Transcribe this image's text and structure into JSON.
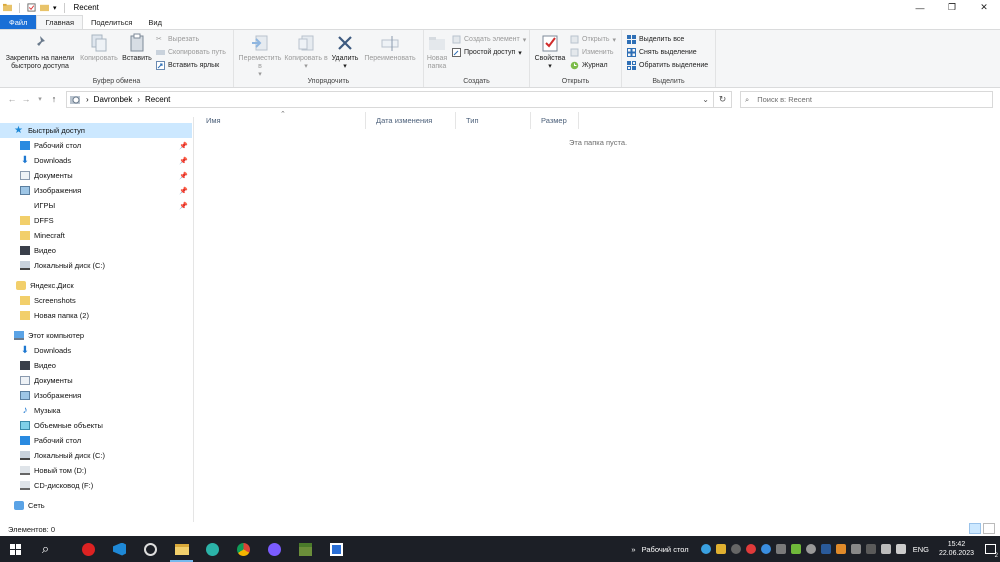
{
  "window": {
    "title": "Recent"
  },
  "tabs": [
    {
      "label": "Файл"
    },
    {
      "label": "Главная"
    },
    {
      "label": "Поделиться"
    },
    {
      "label": "Вид"
    }
  ],
  "ribbon": {
    "clipboard": {
      "label": "Буфер обмена",
      "pin_label": "Закрепить на панели быстрого доступа",
      "copy": "Копировать",
      "paste": "Вставить",
      "cut": "Вырезать",
      "copy_path": "Скопировать путь",
      "paste_shortcut": "Вставить ярлык"
    },
    "organize": {
      "label": "Упорядочить",
      "move": "Переместить в",
      "copy_to": "Копировать в",
      "delete": "Удалить",
      "rename": "Переименовать"
    },
    "create": {
      "label": "Создать",
      "new_folder": "Новая папка",
      "new_item": "Создать элемент",
      "easy_access": "Простой доступ"
    },
    "open": {
      "label": "Открыть",
      "properties": "Свойства",
      "open": "Открыть",
      "edit": "Изменить",
      "history": "Журнал"
    },
    "select": {
      "label": "Выделить",
      "select_all": "Выделить все",
      "select_none": "Снять выделение",
      "invert": "Обратить выделение"
    }
  },
  "address": {
    "crumbs": [
      "Davronbek",
      "Recent"
    ],
    "search_placeholder": "Поиск в: Recent"
  },
  "nav": {
    "quick": {
      "label": "Быстрый доступ",
      "items": [
        "Рабочий стол",
        "Downloads",
        "Документы",
        "Изображения",
        "ИГРЫ",
        "DFFS",
        "Minecraft",
        "Видео",
        "Локальный диск (C:)"
      ]
    },
    "yandex": {
      "label": "Яндекс.Диск",
      "items": [
        "Screenshots",
        "Новая папка (2)"
      ]
    },
    "pc": {
      "label": "Этот компьютер",
      "items": [
        "Downloads",
        "Видео",
        "Документы",
        "Изображения",
        "Музыка",
        "Объемные объекты",
        "Рабочий стол",
        "Локальный диск (C:)",
        "Новый том (D:)",
        "CD-дисковод (F:)"
      ]
    },
    "network": {
      "label": "Сеть"
    }
  },
  "columns": [
    "Имя",
    "Дата изменения",
    "Тип",
    "Размер"
  ],
  "empty_text": "Эта папка пуста.",
  "status": {
    "items_count": "Элементов: 0"
  },
  "taskbar": {
    "desktop_label": "Рабочий стол",
    "lang": "ENG",
    "time": "15:42",
    "date": "22.06.2023",
    "badge": "2"
  },
  "colors": {
    "accent": "#1a6fd6",
    "selection": "#cce8ff",
    "taskbar": "#1c1f26"
  }
}
